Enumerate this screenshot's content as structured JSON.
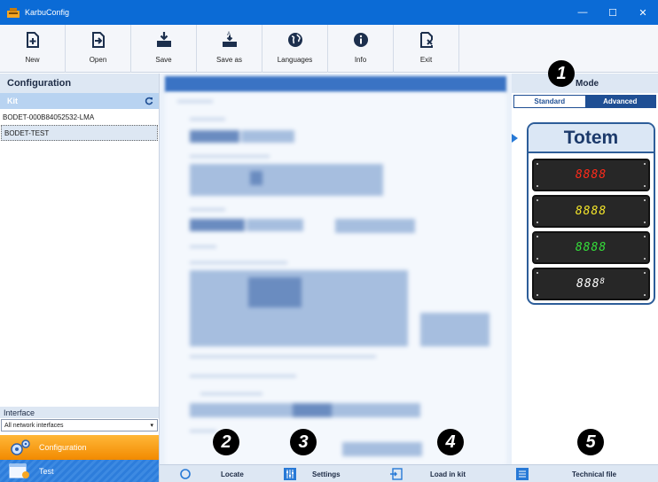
{
  "window": {
    "title": "KarbuConfig"
  },
  "toolbar": {
    "buttons": [
      {
        "label": "New",
        "icon": "new-file-icon"
      },
      {
        "label": "Open",
        "icon": "open-icon"
      },
      {
        "label": "Save",
        "icon": "save-icon"
      },
      {
        "label": "Save as",
        "icon": "save-as-icon"
      },
      {
        "label": "Languages",
        "icon": "globe-icon"
      },
      {
        "label": "Info",
        "icon": "info-icon"
      },
      {
        "label": "Exit",
        "icon": "exit-icon"
      }
    ]
  },
  "left": {
    "title": "Configuration",
    "kit_header": "Kit",
    "kits": [
      "BODET-000B84052532-LMA",
      "BODET-TEST"
    ],
    "interface_header": "Interface",
    "interface_value": "All network interfaces",
    "nav": {
      "configuration": "Configuration",
      "test": "Test"
    }
  },
  "right": {
    "mode_title": "Mode",
    "tabs": {
      "standard": "Standard",
      "advanced": "Advanced"
    },
    "totem": {
      "title": "Totem",
      "displays": [
        {
          "text": "8888",
          "color": "#ff2a1a"
        },
        {
          "text": "8888",
          "color": "#f5e62a"
        },
        {
          "text": "8888",
          "color": "#35e03a"
        },
        {
          "text": "888",
          "small": "8",
          "color": "#ffffff"
        }
      ]
    }
  },
  "statusbar": {
    "locate": "Locate",
    "settings": "Settings",
    "load": "Load in kit",
    "technical": "Technical file"
  },
  "markers": [
    "1",
    "2",
    "3",
    "4",
    "5"
  ],
  "colors": {
    "titlebar": "#0b6bd6",
    "accent": "#1f4f94",
    "nav_active": "#f28a00",
    "panel_header": "#dde7f3"
  }
}
